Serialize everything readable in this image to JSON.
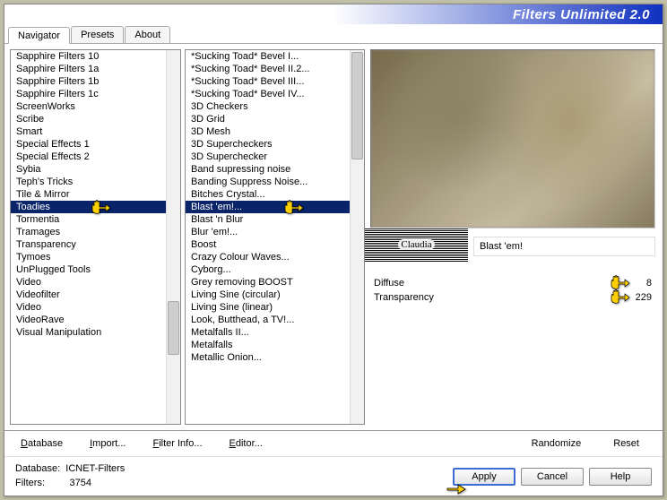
{
  "app": {
    "title": "Filters Unlimited 2.0"
  },
  "tabs": [
    "Navigator",
    "Presets",
    "About"
  ],
  "activeTab": 0,
  "leftList": {
    "selectedIndex": 12,
    "items": [
      "Sapphire Filters 10",
      "Sapphire Filters 1a",
      "Sapphire Filters 1b",
      "Sapphire Filters 1c",
      "ScreenWorks",
      "Scribe",
      "Smart",
      "Special Effects 1",
      "Special Effects 2",
      "Sybia",
      "Teph's Tricks",
      "Tile & Mirror",
      "Toadies",
      "Tormentia",
      "Tramages",
      "Transparency",
      "Tymoes",
      "UnPlugged Tools",
      "Video",
      "Videofilter",
      "Video",
      "VideoRave",
      "Visual Manipulation"
    ]
  },
  "midList": {
    "selectedIndex": 12,
    "items": [
      "*Sucking Toad*  Bevel I...",
      "*Sucking Toad*  Bevel II.2...",
      "*Sucking Toad*  Bevel III...",
      "*Sucking Toad*  Bevel IV...",
      "3D Checkers",
      "3D Grid",
      "3D Mesh",
      "3D Supercheckers",
      "3D Superchecker",
      "Band supressing noise",
      "Banding Suppress Noise...",
      "Bitches Crystal...",
      "Blast 'em!...",
      "Blast 'n Blur",
      "Blur 'em!...",
      "Boost",
      "Crazy Colour Waves...",
      "Cyborg...",
      "Grey removing BOOST",
      "Living Sine (circular)",
      "Living Sine (linear)",
      "Look, Butthead, a TV!...",
      "Metalfalls II...",
      "Metalfalls",
      "Metallic Onion..."
    ]
  },
  "preview": {
    "filterName": "Blast 'em!"
  },
  "params": [
    {
      "label": "Diffuse",
      "value": 8
    },
    {
      "label": "Transparency",
      "value": 229
    }
  ],
  "toolbar": {
    "database": "Database",
    "import": "Import...",
    "filterInfo": "Filter Info...",
    "editor": "Editor...",
    "randomize": "Randomize",
    "reset": "Reset"
  },
  "status": {
    "dbLabel": "Database:",
    "dbName": "ICNET-Filters",
    "filtersLabel": "Filters:",
    "count": "3754"
  },
  "buttons": {
    "apply": "Apply",
    "cancel": "Cancel",
    "help": "Help"
  }
}
